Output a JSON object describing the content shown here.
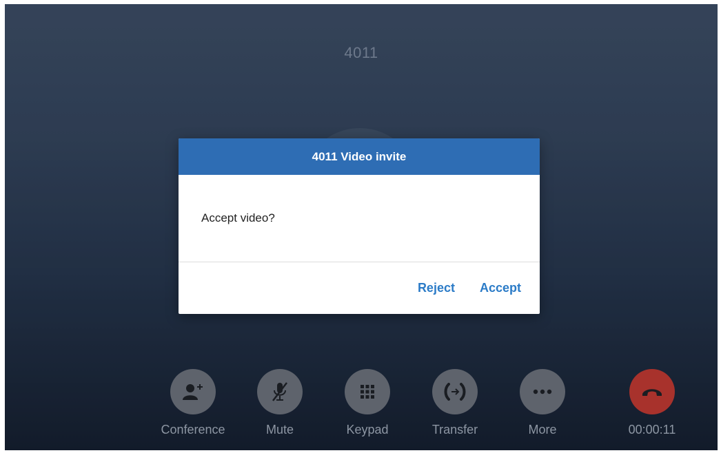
{
  "call": {
    "caller_number": "4011",
    "timer": "00:00:11"
  },
  "dialog": {
    "title": "4011 Video invite",
    "message": "Accept video?",
    "reject_label": "Reject",
    "accept_label": "Accept"
  },
  "controls": {
    "conference_label": "Conference",
    "mute_label": "Mute",
    "keypad_label": "Keypad",
    "transfer_label": "Transfer",
    "more_label": "More"
  },
  "icons": [
    "add-contact-icon",
    "mic-off-icon",
    "keypad-icon",
    "transfer-icon",
    "more-icon",
    "hangup-icon"
  ],
  "colors": {
    "dialog_header": "#2e6db4",
    "action_text": "#2b7bc7",
    "hangup": "#a8322c"
  }
}
